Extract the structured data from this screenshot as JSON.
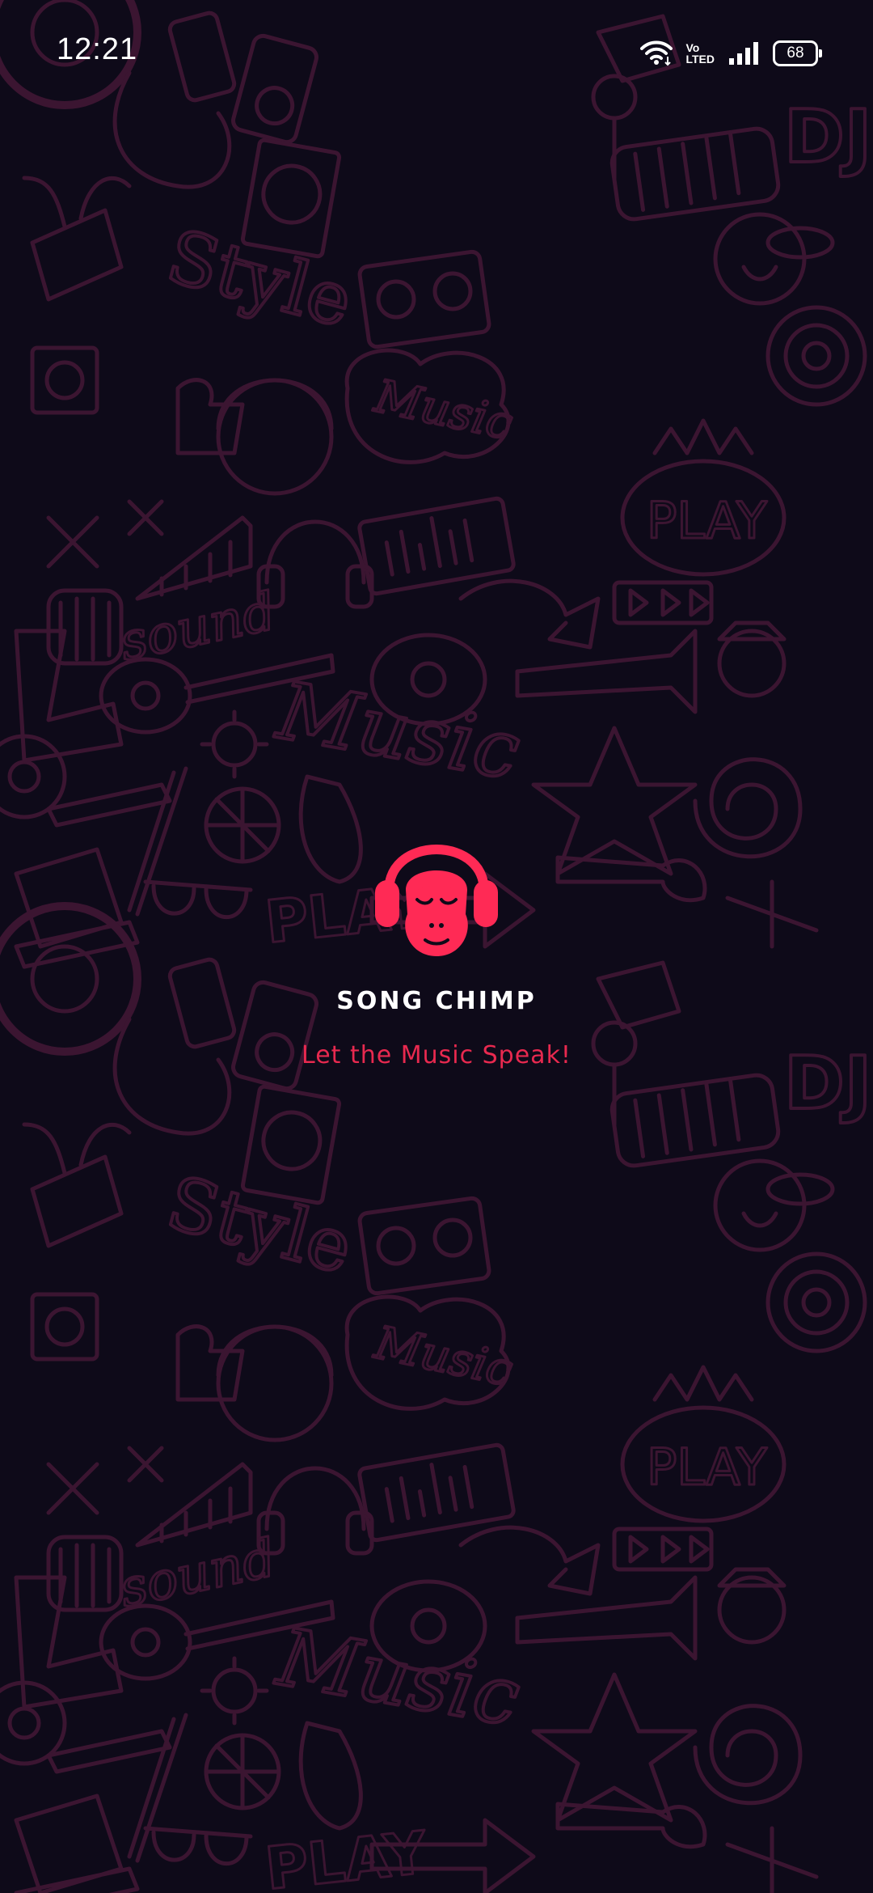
{
  "status_bar": {
    "time": "12:21",
    "battery_level": "68",
    "volte_top": "Vo",
    "volte_bottom": "LTED",
    "icons": [
      "wifi-icon",
      "volte-icon",
      "signal-icon",
      "battery-icon"
    ]
  },
  "splash": {
    "app_name": "SONG CHIMP",
    "tagline": "Let the Music Speak!",
    "logo_icon": "chimp-headphones-logo"
  },
  "background": {
    "pattern": "music-doodles",
    "doodle_words": [
      "Music",
      "Style",
      "sound",
      "PLAY",
      "DJ",
      "Music",
      "Style",
      "sound",
      "PLAY",
      "DJ"
    ]
  },
  "colors": {
    "background": "#0e0a19",
    "doodle": "#3a1430",
    "accent": "#ff2a55",
    "text_primary": "#ffffff"
  }
}
